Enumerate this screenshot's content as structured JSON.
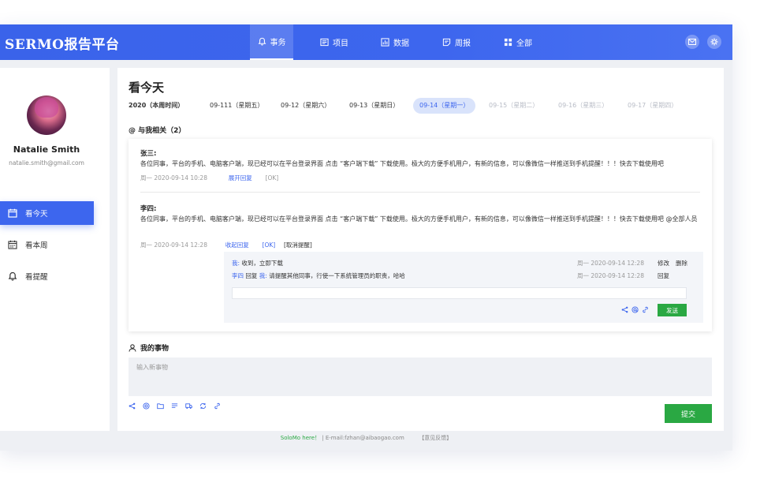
{
  "header": {
    "logo": "SERMO报告平台",
    "nav": [
      {
        "label": "事务",
        "icon": "bell-icon"
      },
      {
        "label": "项目",
        "icon": "list-icon"
      },
      {
        "label": "数据",
        "icon": "chart-icon"
      },
      {
        "label": "周报",
        "icon": "report-icon"
      },
      {
        "label": "全部",
        "icon": "grid-icon"
      }
    ],
    "active_nav": "事务",
    "right_icons": [
      "mail-icon",
      "gear-icon"
    ]
  },
  "user": {
    "name": "Natalie  Smith",
    "email": "natalie.smith@gmail.com"
  },
  "sidebar": {
    "items": [
      {
        "label": "看今天",
        "icon": "calendar-icon"
      },
      {
        "label": "看本周",
        "icon": "calendar-week-icon"
      },
      {
        "label": "看提醒",
        "icon": "bell-icon"
      }
    ],
    "active": "看今天"
  },
  "main": {
    "title": "看今天",
    "dates": [
      {
        "label": "2020（本周时间）"
      },
      {
        "label": "09-111（星期五）"
      },
      {
        "label": "09-12（星期六）"
      },
      {
        "label": "09-13（星期日）"
      },
      {
        "label": "09-14（星期一）"
      },
      {
        "label": "09-15（星期二）"
      },
      {
        "label": "09-16（星期三）"
      },
      {
        "label": "09-17（星期四）"
      }
    ],
    "related_header": "@ 与我相关（2）",
    "messages": [
      {
        "name": "张三:",
        "text": "各位同事，平台的手机、电脑客户端，现已经可以在平台登录界面 点击 “客户端下载” 下载使用。极大的方便手机用户，有新的信息，可以像微信一样推送到手机提醒！！！快去下载使用吧",
        "meta_time": "周一   2020-09-14  10:28",
        "meta_link": "展开回复",
        "meta_ok": "[OK]"
      },
      {
        "name": "李四:",
        "text": "各位同事，平台的手机、电脑客户端，现已经可以在平台登录界面 点击 “客户端下载” 下载使用。极大的方便手机用户，有新的信息，可以像微信一样推送到手机提醒！！！快去下载使用吧 @全部人员",
        "meta_time": "周一   2020-09-14  12:28",
        "meta_link": "收起回复",
        "meta_ok": "[OK]",
        "meta_cancel": "[取消提醒]"
      }
    ],
    "replies": [
      {
        "who": "我:",
        "text": " 收到，立即下载",
        "time": "周一   2020-09-14  12:28",
        "actions": [
          "修改",
          "删除"
        ]
      },
      {
        "who": "李四",
        "mid": " 回复 ",
        "who2": "我:",
        "text": " 请提醒其他同事，行使一下系统管理员的职责，哈哈",
        "time": "周一   2020-09-14  12:28",
        "actions": [
          "回复"
        ]
      }
    ],
    "send_label": "发送",
    "my_tasks_header": "我的事物",
    "new_task_placeholder": "输入新事物",
    "submit_label": "提交"
  },
  "footer": {
    "brand": "SoloMo here！",
    "email": "| E-mail:fzhan@aibaogao.com",
    "feedback": "【意见反馈】"
  },
  "colors": {
    "primary": "#3d66ee",
    "green": "#2aa843"
  }
}
